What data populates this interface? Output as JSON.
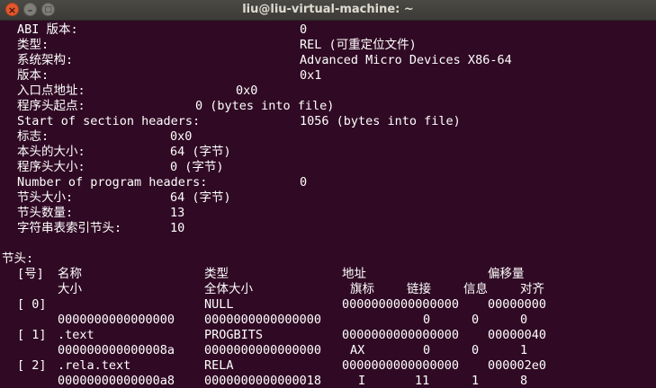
{
  "window": {
    "title": "liu@liu-virtual-machine: ~",
    "buttons": {
      "close": "×",
      "minimize": "–",
      "maximize": "□"
    }
  },
  "elf_header": [
    {
      "label": "ABI 版本:",
      "value": "0"
    },
    {
      "label": "类型:",
      "value": "REL (可重定位文件)"
    },
    {
      "label": "系统架构:",
      "value": "Advanced Micro Devices X86-64"
    },
    {
      "label": "版本:",
      "value": "0x1"
    },
    {
      "label": "入口点地址:",
      "value": "0x0"
    },
    {
      "label": "程序头起点:",
      "value": "0 (bytes into file)"
    },
    {
      "label": "Start of section headers:",
      "value": "1056 (bytes into file)"
    },
    {
      "label": "标志:",
      "value": "0x0"
    },
    {
      "label": "本头的大小:",
      "value": "64 (字节)"
    },
    {
      "label": "程序头大小:",
      "value": "0 (字节)"
    },
    {
      "label": "Number of program headers:",
      "value": "0"
    },
    {
      "label": "节头大小:",
      "value": "64 (字节)"
    },
    {
      "label": "节头数量:",
      "value": "13"
    },
    {
      "label": "字符串表索引节头:",
      "value": "10"
    }
  ],
  "section_headers": {
    "title": "节头:",
    "columns_row1": {
      "num": "[号]",
      "name": "名称",
      "type": "类型",
      "address": "地址",
      "offset": "偏移量"
    },
    "columns_row2": {
      "size": "大小",
      "entsize": "全体大小",
      "flags": "旗标",
      "link": "链接",
      "info": "信息",
      "align": "对齐"
    },
    "rows": [
      {
        "num": "[ 0]",
        "name": "",
        "type": "NULL",
        "address": "0000000000000000",
        "offset": "00000000",
        "size": "0000000000000000",
        "entsize": "0000000000000000",
        "flags": "",
        "link": "0",
        "info": "0",
        "align": "0"
      },
      {
        "num": "[ 1]",
        "name": ".text",
        "type": "PROGBITS",
        "address": "0000000000000000",
        "offset": "00000040",
        "size": "000000000000008a",
        "entsize": "0000000000000000",
        "flags": "AX",
        "link": "0",
        "info": "0",
        "align": "1"
      },
      {
        "num": "[ 2]",
        "name": ".rela.text",
        "type": "RELA",
        "address": "0000000000000000",
        "offset": "000002e0",
        "size": "00000000000000a8",
        "entsize": "0000000000000018",
        "flags": "I",
        "link": "11",
        "info": "1",
        "align": "8"
      }
    ]
  }
}
